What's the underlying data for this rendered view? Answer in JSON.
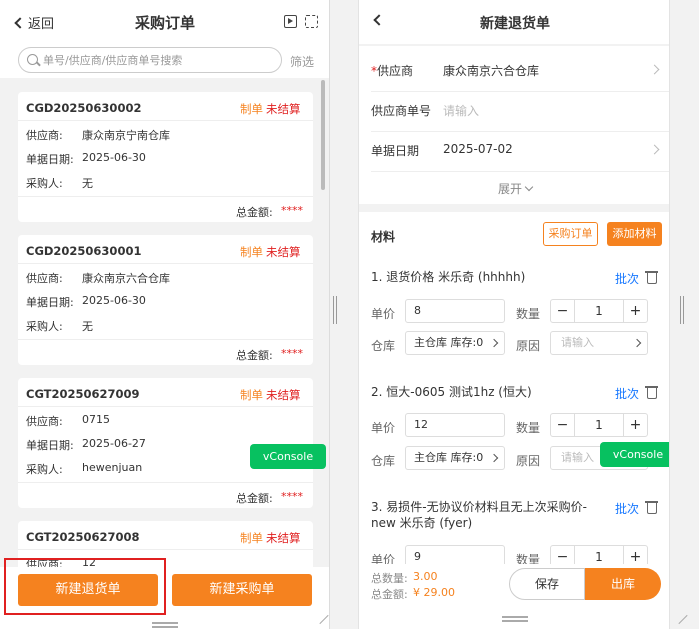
{
  "left": {
    "header": {
      "back_label": "返回",
      "title": "采购订单"
    },
    "search": {
      "placeholder": "单号/供应商/供应商单号搜索",
      "filter_label": "筛选"
    },
    "field_labels": {
      "supplier": "供应商:",
      "date": "单据日期:",
      "buyer": "采购人:",
      "total": "总金额:"
    },
    "orders": [
      {
        "no": "CGD20250630002",
        "status1": "制单",
        "status2": "未结算",
        "supplier": "康众南京宁南仓库",
        "date": "2025-06-30",
        "buyer": "无",
        "total": "****"
      },
      {
        "no": "CGD20250630001",
        "status1": "制单",
        "status2": "未结算",
        "supplier": "康众南京六合仓库",
        "date": "2025-06-30",
        "buyer": "无",
        "total": "****"
      },
      {
        "no": "CGT20250627009",
        "status1": "制单",
        "status2": "未结算",
        "supplier": "0715",
        "date": "2025-06-27",
        "buyer": "hewenjuan",
        "total": "****"
      },
      {
        "no": "CGT20250627008",
        "status1": "制单",
        "status2": "未结算",
        "supplier": "12",
        "date": "",
        "buyer": "",
        "total": ""
      }
    ],
    "vconsole": "vConsole",
    "footer": {
      "return_btn": "新建退货单",
      "purchase_btn": "新建采购单"
    }
  },
  "right": {
    "header": {
      "title": "新建退货单"
    },
    "form": {
      "supplier_label": "供应商",
      "supplier_value": "康众南京六合仓库",
      "supplier_no_label": "供应商单号",
      "supplier_no_placeholder": "请输入",
      "date_label": "单据日期",
      "date_value": "2025-07-02",
      "expand_label": "展开"
    },
    "materials": {
      "title": "材料",
      "po_btn": "采购订单",
      "add_btn": "添加材料",
      "labels": {
        "price": "单价",
        "qty": "数量",
        "warehouse": "仓库",
        "reason": "原因",
        "batch": "批次",
        "reason_placeholder": "请输入"
      },
      "items": [
        {
          "name": "1. 退货价格 米乐奇 (hhhhh)",
          "price": "8",
          "qty": "1",
          "warehouse": "主仓库 库存:0"
        },
        {
          "name": "2. 恒大-0605 测试1hz (恒大)",
          "price": "12",
          "qty": "1",
          "warehouse": "主仓库 库存:0"
        },
        {
          "name": "3. 易损件-无协议价材料且无上次采购价-new 米乐奇 (fyer)",
          "price": "9",
          "qty": "1",
          "warehouse": ""
        }
      ]
    },
    "vconsole": "vConsole",
    "footer": {
      "total_qty_label": "总数量:",
      "total_qty_value": "3.00",
      "total_amount_label": "总金额:",
      "total_amount_value": "¥ 29.00",
      "save_btn": "保存",
      "out_btn": "出库"
    }
  }
}
